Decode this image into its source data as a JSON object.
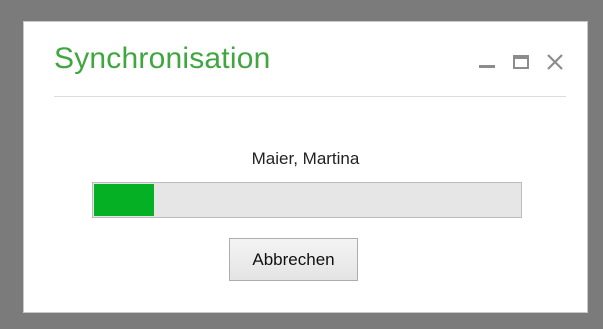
{
  "window": {
    "title": "Synchronisation",
    "controls": [
      "minimize-icon",
      "maximize-icon",
      "close-icon"
    ]
  },
  "status": {
    "current_item": "Maier, Martina"
  },
  "progress": {
    "fraction": 0.14,
    "fill_color": "#06b025"
  },
  "actions": {
    "cancel_label": "Abbrechen"
  },
  "colors": {
    "title": "#3fa640",
    "accent": "#06b025"
  }
}
